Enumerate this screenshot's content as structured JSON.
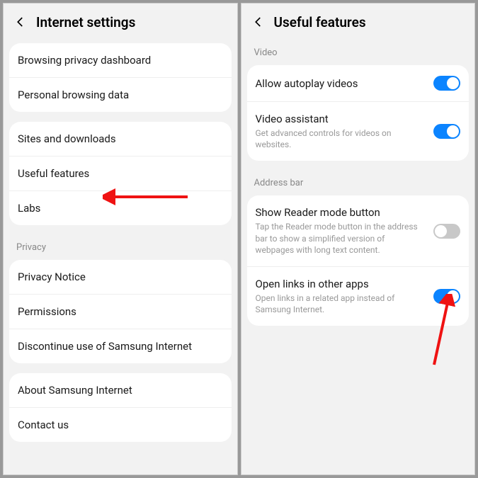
{
  "left": {
    "title": "Internet settings",
    "group1": [
      "Browsing privacy dashboard",
      "Personal browsing data"
    ],
    "group2": [
      "Sites and downloads",
      "Useful features",
      "Labs"
    ],
    "privacy_label": "Privacy",
    "group3": [
      "Privacy Notice",
      "Permissions",
      "Discontinue use of Samsung Internet"
    ],
    "group4": [
      "About Samsung Internet",
      "Contact us"
    ]
  },
  "right": {
    "title": "Useful features",
    "video_label": "Video",
    "video_items": [
      {
        "title": "Allow autoplay videos",
        "desc": "",
        "on": true
      },
      {
        "title": "Video assistant",
        "desc": "Get advanced controls for videos on websites.",
        "on": true
      }
    ],
    "address_label": "Address bar",
    "address_items": [
      {
        "title": "Show Reader mode button",
        "desc": "Tap the Reader mode button in the address bar to show a simplified version of webpages with long text content.",
        "on": false
      },
      {
        "title": "Open links in other apps",
        "desc": "Open links in a related app instead of Samsung Internet.",
        "on": true
      }
    ]
  }
}
